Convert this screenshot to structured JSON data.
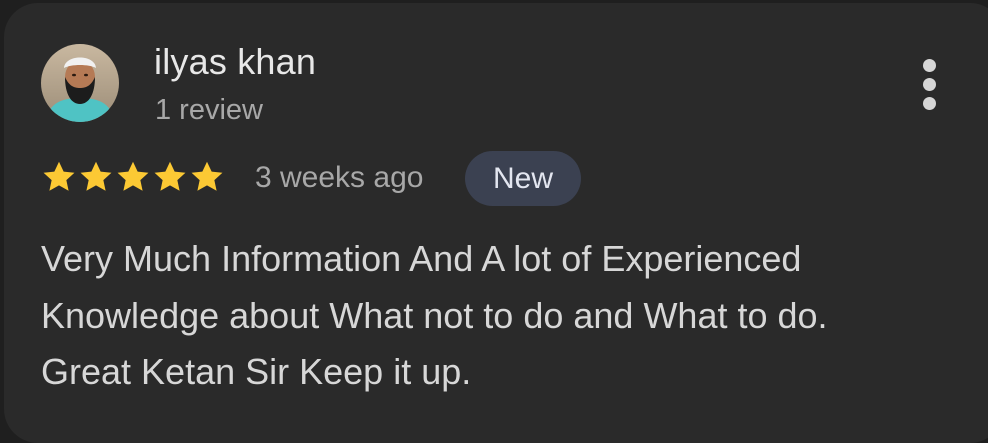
{
  "review": {
    "author_name": "ilyas khan",
    "author_review_count": "1 review",
    "rating": 5,
    "rating_max": 5,
    "time_ago": "3 weeks ago",
    "badge": "New",
    "text_lines": [
      "Very Much Information And A lot of Experienced",
      "Knowledge about What not to do and What to do.",
      "Great Ketan Sir Keep it up."
    ]
  },
  "icons": {
    "avatar": "avatar-photo",
    "more": "more-vert-icon",
    "star": "star-icon"
  },
  "colors": {
    "card_background": "#2a2a2a",
    "star": "#fcc934",
    "badge_background": "#3b4151"
  }
}
